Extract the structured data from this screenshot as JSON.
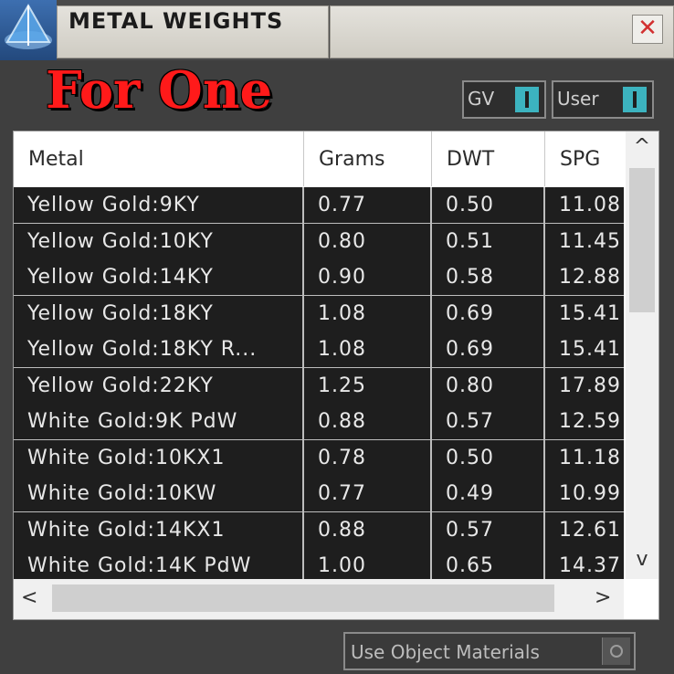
{
  "window": {
    "title": "METAL WEIGHTS",
    "close_symbol": "✕"
  },
  "header": {
    "quantity_label": "For One"
  },
  "toggles": [
    {
      "label": "GV",
      "state": "on"
    },
    {
      "label": "User",
      "state": "on"
    }
  ],
  "table": {
    "columns": [
      "Metal",
      "Grams",
      "DWT",
      "SPG"
    ],
    "rows": [
      [
        "Yellow Gold:9KY",
        "0.77",
        "0.50",
        "11.08"
      ],
      [
        "Yellow Gold:10KY",
        "0.80",
        "0.51",
        "11.45"
      ],
      [
        "Yellow Gold:14KY",
        "0.90",
        "0.58",
        "12.88"
      ],
      [
        "Yellow Gold:18KY",
        "1.08",
        "0.69",
        "15.41"
      ],
      [
        "Yellow Gold:18KY R...",
        "1.08",
        "0.69",
        "15.41"
      ],
      [
        "Yellow Gold:22KY",
        "1.25",
        "0.80",
        "17.89"
      ],
      [
        "White Gold:9K PdW",
        "0.88",
        "0.57",
        "12.59"
      ],
      [
        "White Gold:10KX1",
        "0.78",
        "0.50",
        "11.18"
      ],
      [
        "White Gold:10KW",
        "0.77",
        "0.49",
        "10.99"
      ],
      [
        "White Gold:14KX1",
        "0.88",
        "0.57",
        "12.61"
      ],
      [
        "White Gold:14K PdW",
        "1.00",
        "0.65",
        "14.37"
      ]
    ]
  },
  "footer": {
    "use_object_materials_label": "Use Object Materials"
  },
  "icons": {
    "up": "^",
    "down": "v",
    "left": "<",
    "right": ">"
  }
}
